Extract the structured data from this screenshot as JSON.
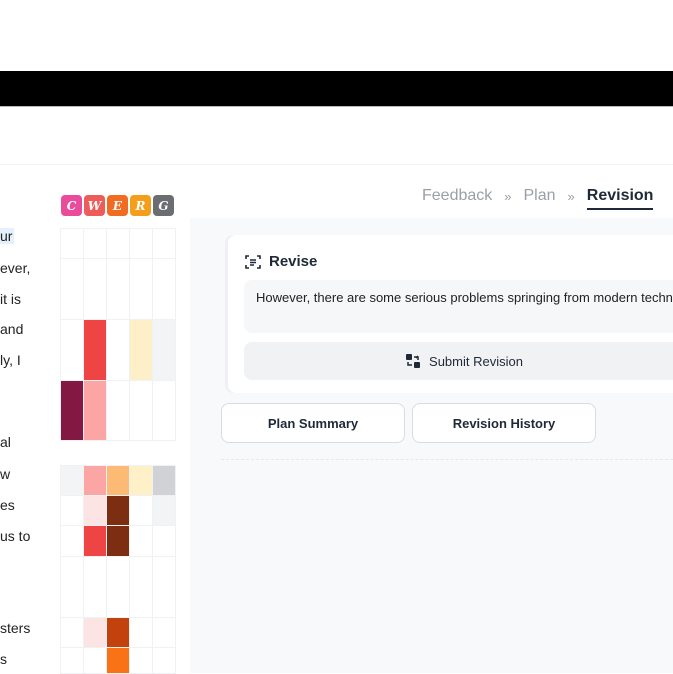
{
  "left_text": {
    "lines": [
      "ur",
      "ever,",
      "it is",
      "and",
      "ly, I",
      "al",
      "w",
      "es",
      "us to",
      "sters",
      "s"
    ]
  },
  "legend": [
    {
      "label": "C",
      "color": "#e84c9a"
    },
    {
      "label": "W",
      "color": "#ee5b5b"
    },
    {
      "label": "E",
      "color": "#f26b22"
    },
    {
      "label": "R",
      "color": "#f59e1b"
    },
    {
      "label": "G",
      "color": "#6b6d72"
    }
  ],
  "heatmap_top": [
    [
      "#ffffff",
      "#ffffff",
      "#ffffff",
      "#ffffff",
      "#ffffff"
    ],
    [
      "#ffffff",
      "#ffffff",
      "#ffffff",
      "#ffffff",
      "#ffffff"
    ],
    [
      "#ffffff",
      "#ef4444",
      "#ffffff",
      "#fdf0c8",
      "#f3f4f6"
    ],
    [
      "#831843",
      "#fca5a5",
      "#ffffff",
      "#ffffff",
      "#ffffff"
    ]
  ],
  "heatmap_bottom": [
    [
      "#f3f4f6",
      "#fca5a5",
      "#fdba74",
      "#fef0c8",
      "#d1d2d5"
    ],
    [
      "#ffffff",
      "#fde4e4",
      "#7c2d12",
      "#ffffff",
      "#f3f4f6"
    ],
    [
      "#ffffff",
      "#ef4444",
      "#7c2d12",
      "#ffffff",
      "#ffffff"
    ],
    [
      "#ffffff",
      "#ffffff",
      "#ffffff",
      "#ffffff",
      "#ffffff"
    ],
    [
      "#ffffff",
      "#fde4e4",
      "#c2410c",
      "#ffffff",
      "#ffffff"
    ],
    [
      "#ffffff",
      "#ffffff",
      "#f97316",
      "#ffffff",
      "#ffffff"
    ]
  ],
  "breadcrumb": {
    "items": [
      "Feedback",
      "Plan",
      "Revision"
    ],
    "separator": "»"
  },
  "revise": {
    "title": "Revise",
    "text": "However, there are some serious problems springing from modern technology",
    "submit_label": "Submit Revision"
  },
  "tabs": {
    "plan_summary": "Plan Summary",
    "revision_history": "Revision History"
  }
}
